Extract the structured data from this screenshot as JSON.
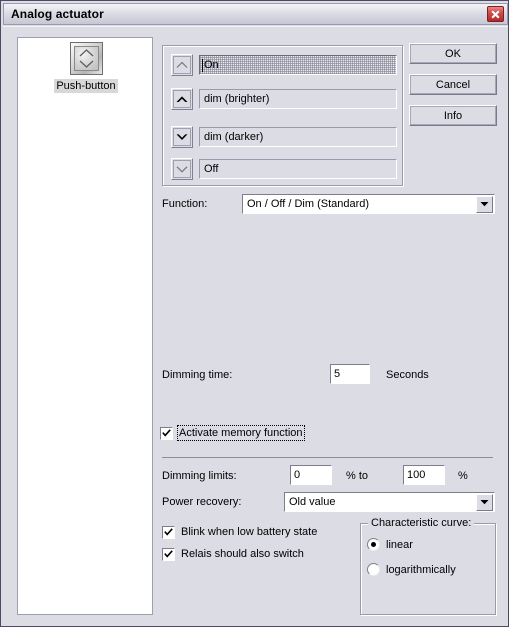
{
  "window": {
    "title": "Analog actuator",
    "close_icon": "close-icon"
  },
  "preview": {
    "device_label": "Push-button",
    "device_icon": "push-button-rocker-icon"
  },
  "actions": {
    "rows": [
      {
        "label": "On",
        "icon": "chevron-up-thin-icon",
        "focused": true
      },
      {
        "label": "dim (brighter)",
        "icon": "chevron-up-bold-icon",
        "focused": false
      },
      {
        "label": "dim (darker)",
        "icon": "chevron-down-bold-icon",
        "focused": false
      },
      {
        "label": "Off",
        "icon": "chevron-down-thin-icon",
        "focused": false
      }
    ]
  },
  "buttons": {
    "ok": "OK",
    "cancel": "Cancel",
    "info": "Info"
  },
  "function": {
    "label": "Function:",
    "value": "On / Off / Dim (Standard)"
  },
  "dimming_time": {
    "label": "Dimming time:",
    "value": "5",
    "unit": "Seconds"
  },
  "memory": {
    "label": "Activate memory function",
    "checked": true
  },
  "dimming_limits": {
    "label": "Dimming limits:",
    "min": "0",
    "between": "% to",
    "max": "100",
    "unit": "%"
  },
  "power_recovery": {
    "label": "Power recovery:",
    "value": "Old value"
  },
  "options": {
    "blink": {
      "label": "Blink when low battery state",
      "checked": true
    },
    "relais": {
      "label": "Relais should also switch",
      "checked": true
    }
  },
  "characteristic_curve": {
    "legend": "Characteristic curve:",
    "options": [
      {
        "label": "linear",
        "selected": true
      },
      {
        "label": "logarithmically",
        "selected": false
      }
    ]
  },
  "colors": {
    "window_bg": "#dcdce4",
    "close_red": "#b22828",
    "field_white": "#ffffff",
    "border_gray": "#9a9aaa"
  }
}
